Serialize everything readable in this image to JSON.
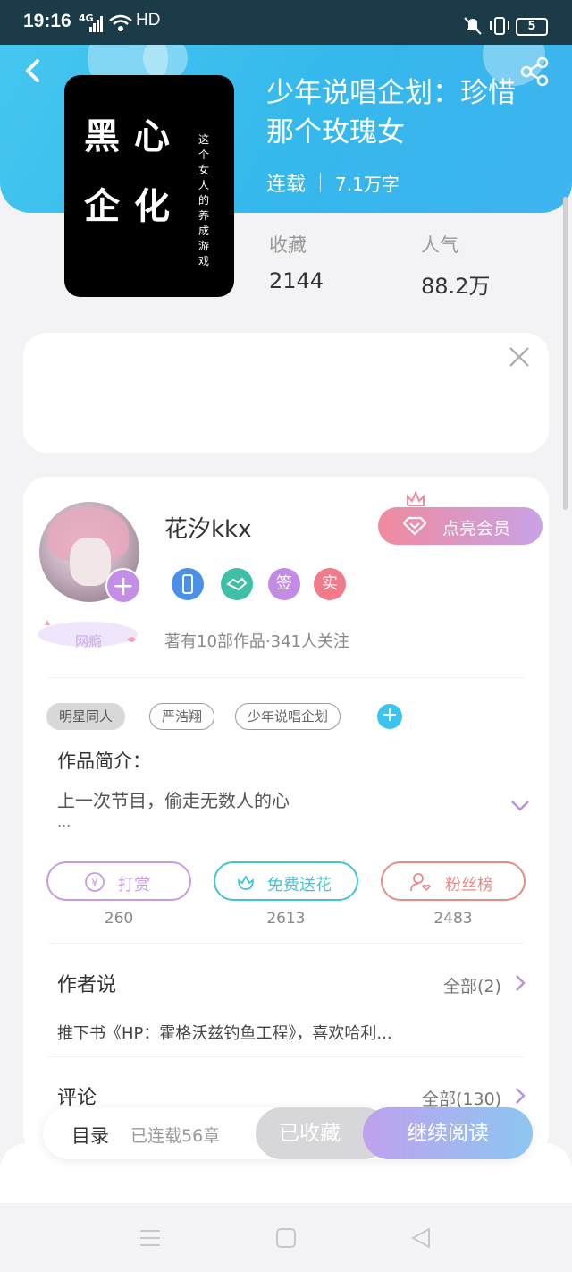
{
  "status_bar": {
    "time": "19:16",
    "network": "4G",
    "hd": "HD",
    "battery": "5"
  },
  "book": {
    "cover_chars": [
      "黑",
      "心",
      "企",
      "化"
    ],
    "cover_subtitle": "这个女人的养成游戏",
    "title": "少年说唱企划：珍惜那个玫瑰女",
    "status": "连载",
    "word_count": "7.1万字",
    "stats": [
      {
        "label": "收藏",
        "value": "2144"
      },
      {
        "label": "人气",
        "value": "88.2万"
      }
    ]
  },
  "author": {
    "name": "花汐kkx",
    "vip_label": "点亮会员",
    "level_tag": "网瘾",
    "badges": [
      {
        "name": "phone-badge",
        "text": "",
        "color": "#4a8fe8"
      },
      {
        "name": "handshake-badge",
        "text": "",
        "color": "#3fbfa6"
      },
      {
        "name": "signed-badge",
        "text": "签",
        "color": "#c48be6"
      },
      {
        "name": "verified-badge",
        "text": "实",
        "color": "#f07a8a"
      }
    ],
    "stats_text": "著有10部作品·341人关注"
  },
  "tags": [
    "明星同人",
    "严浩翔",
    "少年说唱企划"
  ],
  "intro": {
    "title": "作品简介：",
    "text": "上一次节目，偷走无数人的心",
    "ellipsis": "..."
  },
  "actions": [
    {
      "label": "打赏",
      "count": "260",
      "color": "#c79be3"
    },
    {
      "label": "免费送花",
      "count": "2613",
      "color": "#3fc6d6"
    },
    {
      "label": "粉丝榜",
      "count": "2483",
      "color": "#e88a88"
    }
  ],
  "author_says": {
    "title": "作者说",
    "more": "全部(2)",
    "text": "推下书《HP：霍格沃兹钓鱼工程》，喜欢哈利..."
  },
  "comments": {
    "title": "评论",
    "more": "全部(130)"
  },
  "bottom_bar": {
    "toc": "目录",
    "chapters": "已连载56章",
    "collected": "已收藏",
    "continue": "继续阅读"
  },
  "colors": {
    "header": "#3fbdf0",
    "accent_purple": "#c28ee6",
    "accent_blue": "#3cc3f0"
  }
}
